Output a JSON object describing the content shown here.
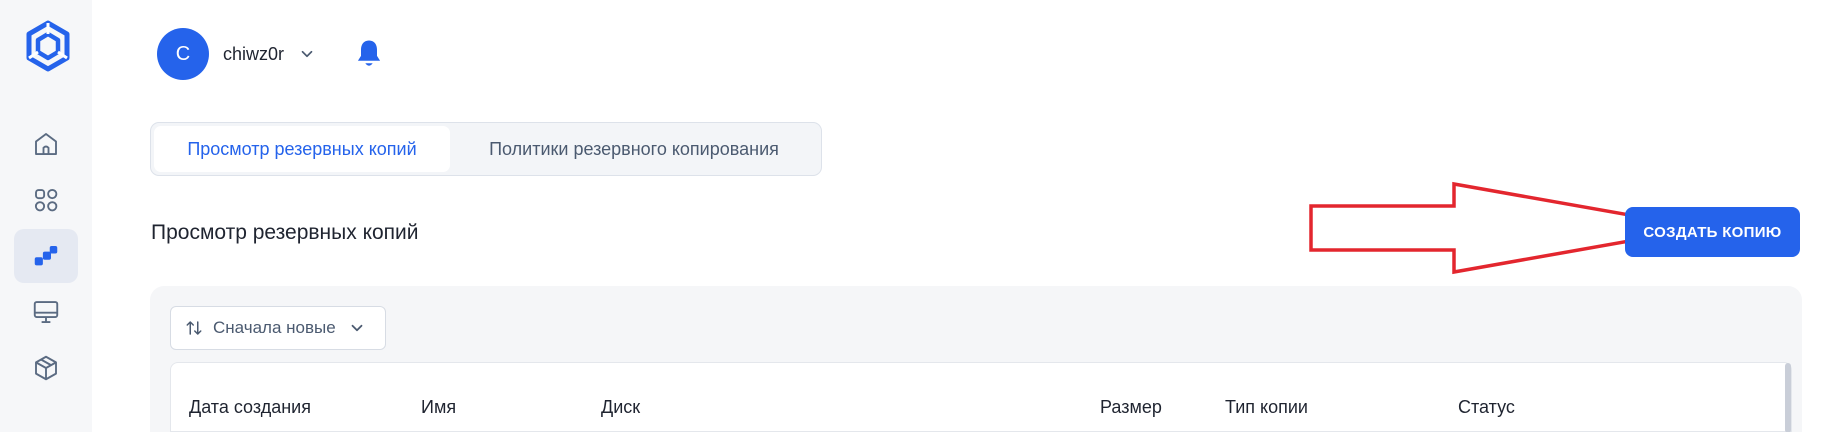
{
  "sidebar": {
    "logo": "logo-icon",
    "items": [
      {
        "icon": "home-icon",
        "active": false
      },
      {
        "icon": "apps-grid-icon",
        "active": false
      },
      {
        "icon": "backup-icon",
        "active": true
      },
      {
        "icon": "monitor-icon",
        "active": false
      },
      {
        "icon": "cube-icon",
        "active": false
      }
    ]
  },
  "header": {
    "avatar_initial": "C",
    "username": "chiwz0r",
    "notification_icon": "bell-icon"
  },
  "tabs": [
    {
      "label": "Просмотр резервных копий",
      "active": true
    },
    {
      "label": "Политики резервного копирования",
      "active": false
    }
  ],
  "section": {
    "title": "Просмотр резервных копий",
    "create_button": "СОЗДАТЬ КОПИЮ"
  },
  "sort": {
    "label": "Сначала новые"
  },
  "table": {
    "columns": [
      "Дата создания",
      "Имя",
      "Диск",
      "Размер",
      "Тип копии",
      "Статус"
    ]
  },
  "colors": {
    "accent": "#2563eb",
    "annotation_arrow": "#e3262e",
    "sidebar_bg": "#f6f7f9"
  }
}
